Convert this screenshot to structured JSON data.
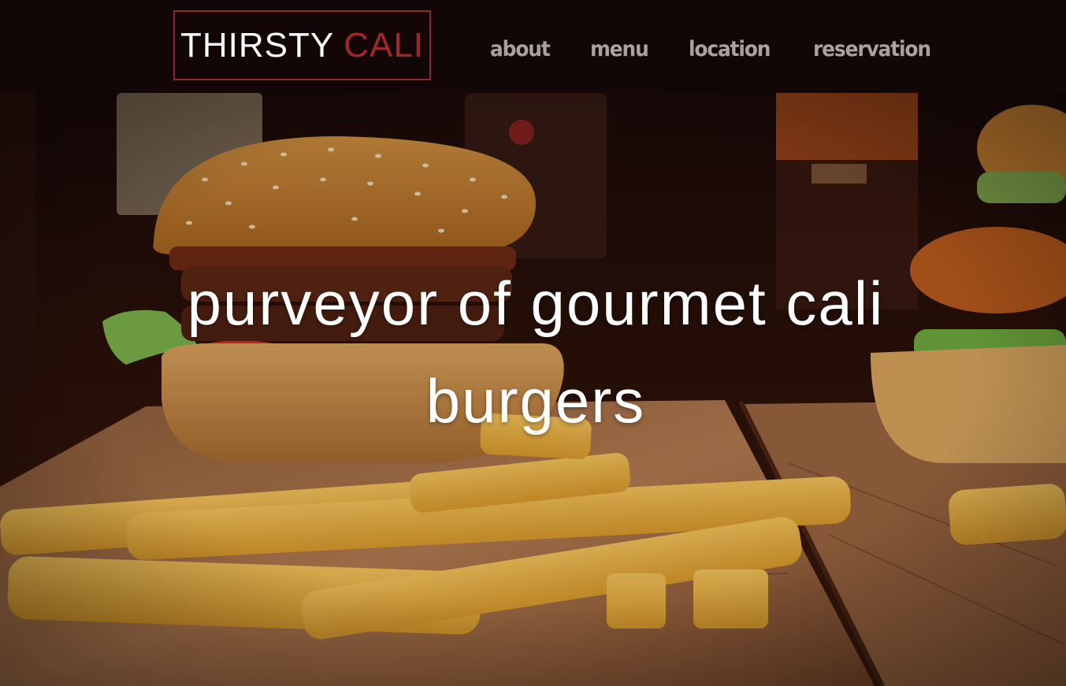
{
  "header": {
    "logo": {
      "word_1": "THIRSTY",
      "word_2": "CALI"
    },
    "nav": [
      {
        "label": "about"
      },
      {
        "label": "menu"
      },
      {
        "label": "location"
      },
      {
        "label": "reservation"
      }
    ]
  },
  "hero": {
    "heading": "purveyor of gourmet cali burgers",
    "image": "burger-and-fries-photo"
  },
  "colors": {
    "navbar_background": "#120606",
    "logo_border": "#8e2a2a",
    "logo_accent": "#a0282a",
    "nav_text": "#a8a39f",
    "heading_text": "#ffffff"
  }
}
